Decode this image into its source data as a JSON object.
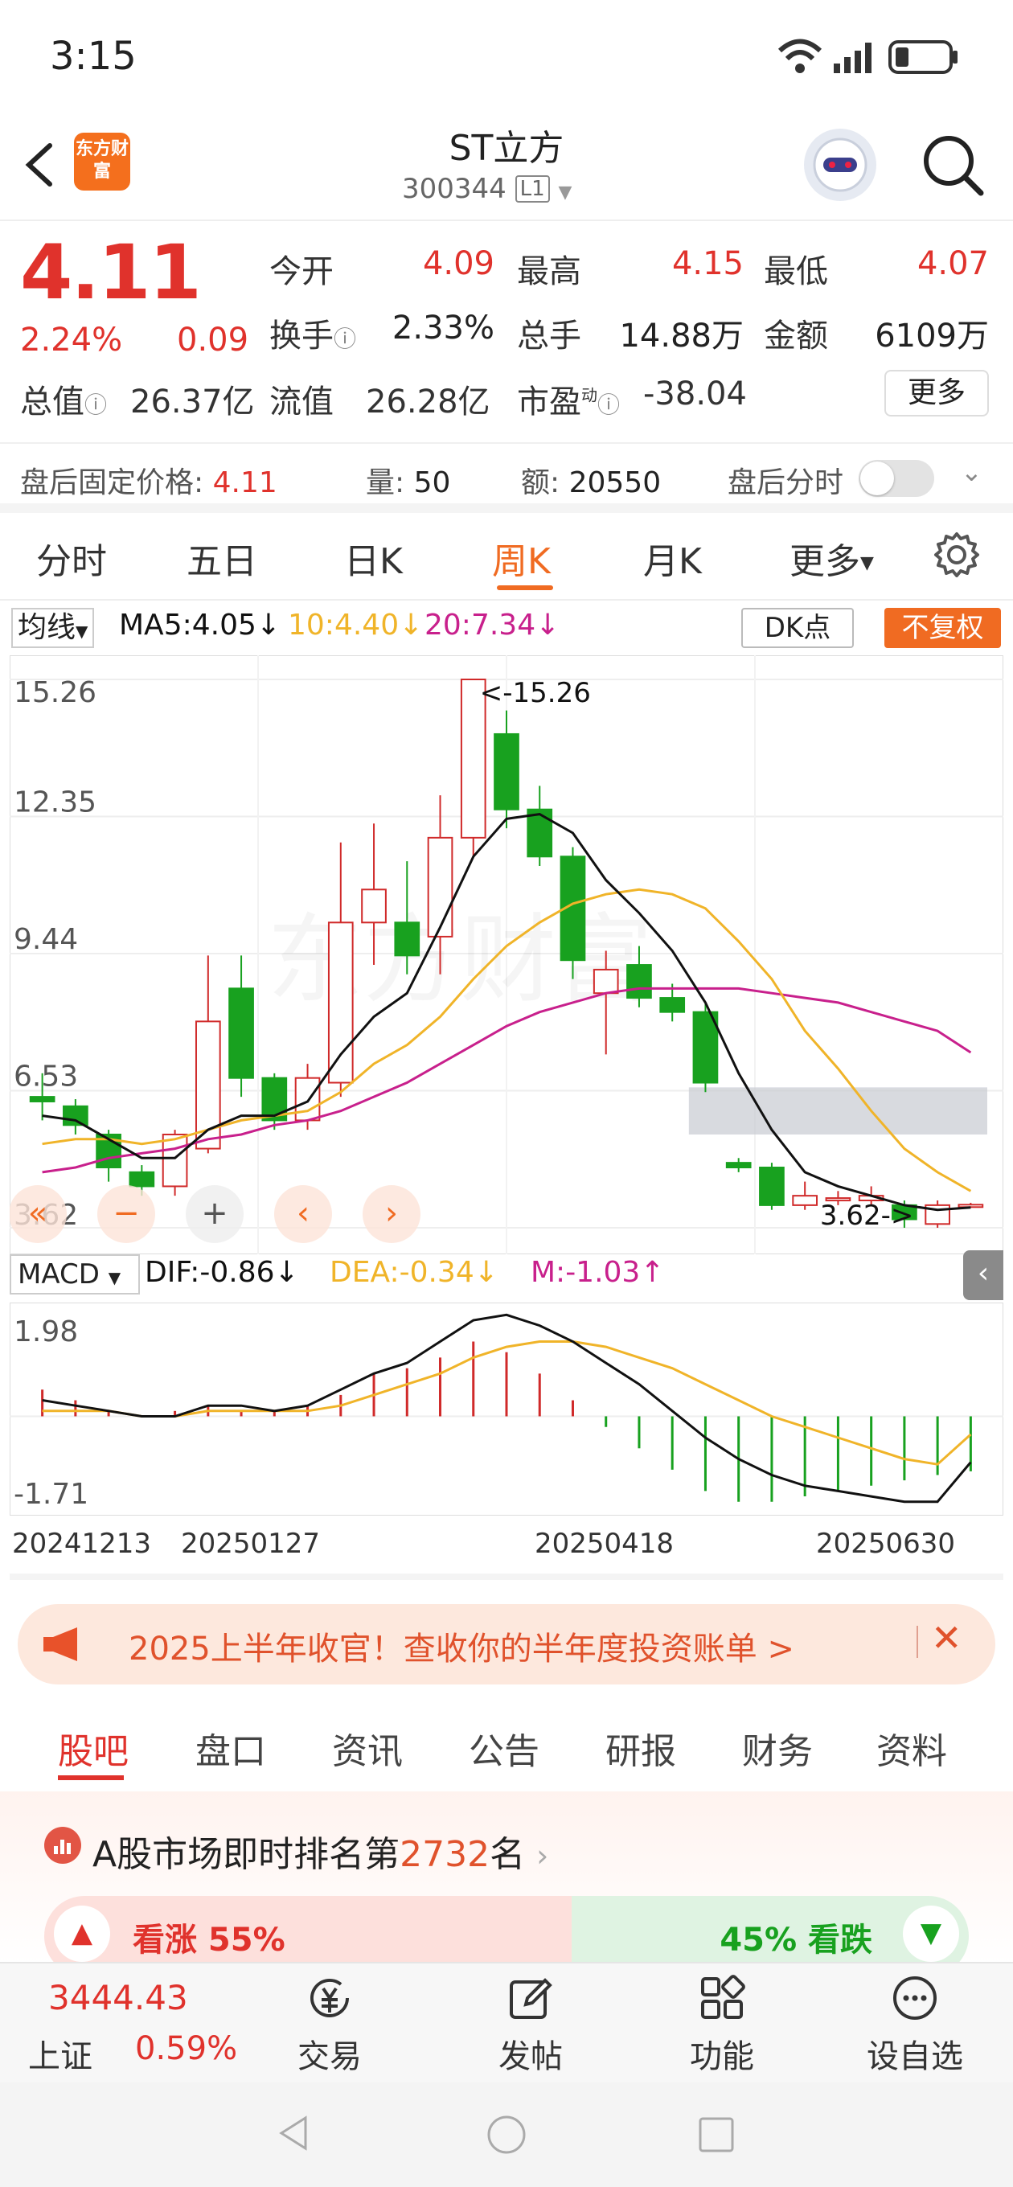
{
  "status_bar": {
    "time": "3:15"
  },
  "header": {
    "title": "ST立方",
    "code": "300344",
    "market_badge": "L1",
    "logo_text": "东方财富"
  },
  "quote": {
    "price": "4.11",
    "change_pct": "2.24%",
    "change": "0.09",
    "rows": [
      [
        {
          "label": "今开",
          "value": "4.09",
          "color": "red"
        },
        {
          "label": "最高",
          "value": "4.15",
          "color": "red"
        },
        {
          "label": "最低",
          "value": "4.07",
          "color": "red"
        }
      ],
      [
        {
          "label": "换手",
          "value": "2.33%",
          "color": "black"
        },
        {
          "label": "总手",
          "value": "14.88万",
          "color": "black"
        },
        {
          "label": "金额",
          "value": "6109万",
          "color": "black"
        }
      ]
    ],
    "total_value_label": "总值",
    "total_value": "26.37亿",
    "float_value_label": "流值",
    "float_value": "26.28亿",
    "pe_label": "市盈",
    "pe_sup": "动",
    "pe_value": "-38.04",
    "more_label": "更多"
  },
  "after_hours": {
    "price_label": "盘后固定价格:",
    "price": "4.11",
    "vol_label": "量:",
    "vol": "50",
    "amt_label": "额:",
    "amt": "20550",
    "timeshare_label": "盘后分时"
  },
  "period_tabs": [
    "分时",
    "五日",
    "日K",
    "周K",
    "月K",
    "更多"
  ],
  "ma_legend": {
    "selector": "均线",
    "ma5": "MA5:4.05↓",
    "ma10": "10:4.40↓",
    "ma20": "20:7.34↓",
    "dk": "DK点",
    "fq": "不复权"
  },
  "colors": {
    "ma5": "#111111",
    "ma10": "#f0b429",
    "ma20": "#c8208c",
    "up": "#d02a2a",
    "down": "#18a11f",
    "accent": "#f06b22"
  },
  "kline": {
    "y_ticks": [
      "15.26",
      "12.35",
      "9.44",
      "6.53",
      "3.62"
    ],
    "y_max": 15.26,
    "y_min": 3.62,
    "max_marker": "<-15.26",
    "min_marker": "3.62->",
    "candles": [
      {
        "o": 6.4,
        "c": 6.3,
        "h": 6.9,
        "l": 5.9
      },
      {
        "o": 6.2,
        "c": 5.8,
        "h": 6.35,
        "l": 5.6
      },
      {
        "o": 5.6,
        "c": 4.9,
        "h": 5.7,
        "l": 4.6
      },
      {
        "o": 4.8,
        "c": 4.5,
        "h": 4.95,
        "l": 4.3
      },
      {
        "o": 4.5,
        "c": 5.6,
        "h": 5.7,
        "l": 4.3
      },
      {
        "o": 5.3,
        "c": 8.0,
        "h": 9.4,
        "l": 5.2
      },
      {
        "o": 8.7,
        "c": 6.8,
        "h": 9.4,
        "l": 6.4
      },
      {
        "o": 6.8,
        "c": 5.9,
        "h": 6.9,
        "l": 5.7
      },
      {
        "o": 5.9,
        "c": 6.8,
        "h": 7.1,
        "l": 5.7
      },
      {
        "o": 6.7,
        "c": 10.1,
        "h": 11.8,
        "l": 6.4
      },
      {
        "o": 10.1,
        "c": 10.8,
        "h": 12.2,
        "l": 9.2
      },
      {
        "o": 10.1,
        "c": 9.4,
        "h": 11.4,
        "l": 9.0
      },
      {
        "o": 9.8,
        "c": 11.9,
        "h": 12.8,
        "l": 9.0
      },
      {
        "o": 11.9,
        "c": 15.26,
        "h": 15.26,
        "l": 11.5
      },
      {
        "o": 14.1,
        "c": 12.5,
        "h": 14.6,
        "l": 12.1
      },
      {
        "o": 12.5,
        "c": 11.5,
        "h": 13.0,
        "l": 11.3
      },
      {
        "o": 11.5,
        "c": 9.3,
        "h": 11.7,
        "l": 8.9
      },
      {
        "o": 8.6,
        "c": 9.1,
        "h": 9.5,
        "l": 7.3
      },
      {
        "o": 9.2,
        "c": 8.5,
        "h": 9.6,
        "l": 8.3
      },
      {
        "o": 8.5,
        "c": 8.2,
        "h": 8.8,
        "l": 8.0
      },
      {
        "o": 8.2,
        "c": 6.7,
        "h": 8.4,
        "l": 6.5
      },
      {
        "o": 5.0,
        "c": 4.9,
        "h": 5.1,
        "l": 4.8
      },
      {
        "o": 4.9,
        "c": 4.1,
        "h": 5.0,
        "l": 4.0
      },
      {
        "o": 4.1,
        "c": 4.3,
        "h": 4.6,
        "l": 4.0
      },
      {
        "o": 4.2,
        "c": 4.25,
        "h": 4.4,
        "l": 4.1
      },
      {
        "o": 4.2,
        "c": 4.3,
        "h": 4.5,
        "l": 4.1
      },
      {
        "o": 4.1,
        "c": 3.8,
        "h": 4.2,
        "l": 3.62
      },
      {
        "o": 3.7,
        "c": 4.1,
        "h": 4.2,
        "l": 3.62
      },
      {
        "o": 4.09,
        "c": 4.11,
        "h": 4.15,
        "l": 4.07
      }
    ],
    "ma5": [
      6.0,
      5.9,
      5.5,
      5.1,
      5.1,
      5.7,
      6.0,
      6.0,
      6.3,
      7.3,
      8.1,
      8.6,
      10.0,
      11.5,
      12.3,
      12.4,
      12.0,
      11.0,
      10.3,
      9.5,
      8.4,
      6.9,
      5.7,
      4.8,
      4.5,
      4.3,
      4.1,
      4.0,
      4.05
    ],
    "ma10": [
      5.4,
      5.5,
      5.5,
      5.4,
      5.5,
      5.7,
      5.9,
      6.0,
      6.1,
      6.5,
      7.1,
      7.5,
      8.1,
      8.9,
      9.6,
      10.1,
      10.5,
      10.7,
      10.8,
      10.7,
      10.4,
      9.7,
      8.9,
      7.8,
      7.0,
      6.1,
      5.3,
      4.8,
      4.4
    ],
    "ma20": [
      4.8,
      4.9,
      5.1,
      5.2,
      5.3,
      5.5,
      5.6,
      5.8,
      5.9,
      6.1,
      6.4,
      6.7,
      7.1,
      7.5,
      7.9,
      8.2,
      8.4,
      8.6,
      8.7,
      8.7,
      8.7,
      8.7,
      8.6,
      8.5,
      8.4,
      8.2,
      8.0,
      7.8,
      7.34
    ],
    "box": {
      "from_index": 20,
      "to_index": 28,
      "low": 5.6,
      "high": 6.6
    },
    "overlay_buttons": [
      "«",
      "−",
      "+",
      "‹",
      "›"
    ]
  },
  "macd": {
    "selector": "MACD",
    "dif": "DIF:-0.86↓",
    "dea": "DEA:-0.34↓",
    "m": "M:-1.03↑",
    "y_ticks": [
      "1.98",
      "-1.71"
    ],
    "y_max": 1.98,
    "y_min": -1.71,
    "dif_values": [
      0.3,
      0.2,
      0.1,
      0.0,
      0.0,
      0.2,
      0.2,
      0.1,
      0.2,
      0.5,
      0.8,
      1.0,
      1.4,
      1.8,
      1.9,
      1.7,
      1.4,
      1.0,
      0.6,
      0.1,
      -0.4,
      -0.8,
      -1.1,
      -1.3,
      -1.4,
      -1.5,
      -1.6,
      -1.6,
      -0.86
    ],
    "dea_values": [
      0.1,
      0.1,
      0.1,
      0.0,
      0.0,
      0.1,
      0.1,
      0.1,
      0.1,
      0.2,
      0.4,
      0.6,
      0.8,
      1.1,
      1.3,
      1.4,
      1.4,
      1.3,
      1.1,
      0.9,
      0.6,
      0.3,
      0.0,
      -0.2,
      -0.4,
      -0.6,
      -0.8,
      -0.9,
      -0.34
    ],
    "m_values": [
      0.5,
      0.3,
      0.1,
      0.0,
      0.1,
      0.2,
      0.1,
      0.1,
      0.2,
      0.4,
      0.8,
      0.9,
      1.1,
      1.4,
      1.2,
      0.8,
      0.3,
      -0.2,
      -0.6,
      -1.0,
      -1.4,
      -1.6,
      -1.6,
      -1.5,
      -1.4,
      -1.3,
      -1.2,
      -1.1,
      -1.03
    ]
  },
  "x_axis": [
    "20241213",
    "20250127",
    "20250418",
    "20250630"
  ],
  "banner": {
    "text": "2025上半年收官！查收你的半年度投资账单 >"
  },
  "info_tabs": [
    "股吧",
    "盘口",
    "资讯",
    "公告",
    "研报",
    "财务",
    "资料"
  ],
  "rank": {
    "prefix": "A股市场即时排名第",
    "rank": "2732",
    "suffix": "名"
  },
  "vote": {
    "up_label": "看涨 55%",
    "down_label": "45% 看跌",
    "up_ratio": 0.55
  },
  "bottom_nav": {
    "index_value": "3444.43",
    "index_name": "上证",
    "index_change": "0.59%",
    "items": [
      "交易",
      "发帖",
      "功能",
      "设自选"
    ]
  }
}
